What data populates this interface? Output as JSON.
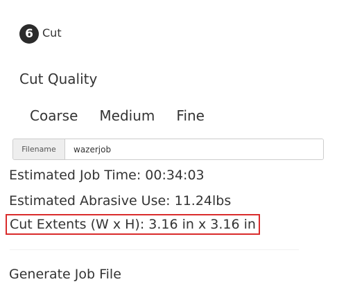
{
  "step": {
    "number": "6",
    "title": "Cut"
  },
  "cut_quality": {
    "heading": "Cut Quality",
    "options": [
      "Coarse",
      "Medium",
      "Fine"
    ]
  },
  "filename": {
    "label": "Filename",
    "value": "wazerjob"
  },
  "stats": {
    "job_time": "Estimated Job Time: 00:34:03",
    "abrasive_use": "Estimated Abrasive Use: 11.24lbs",
    "cut_extents": "Cut Extents (W x H): 3.16 in x 3.16 in"
  },
  "highlight_color": "#d92b2b",
  "generate_label": "Generate Job File"
}
